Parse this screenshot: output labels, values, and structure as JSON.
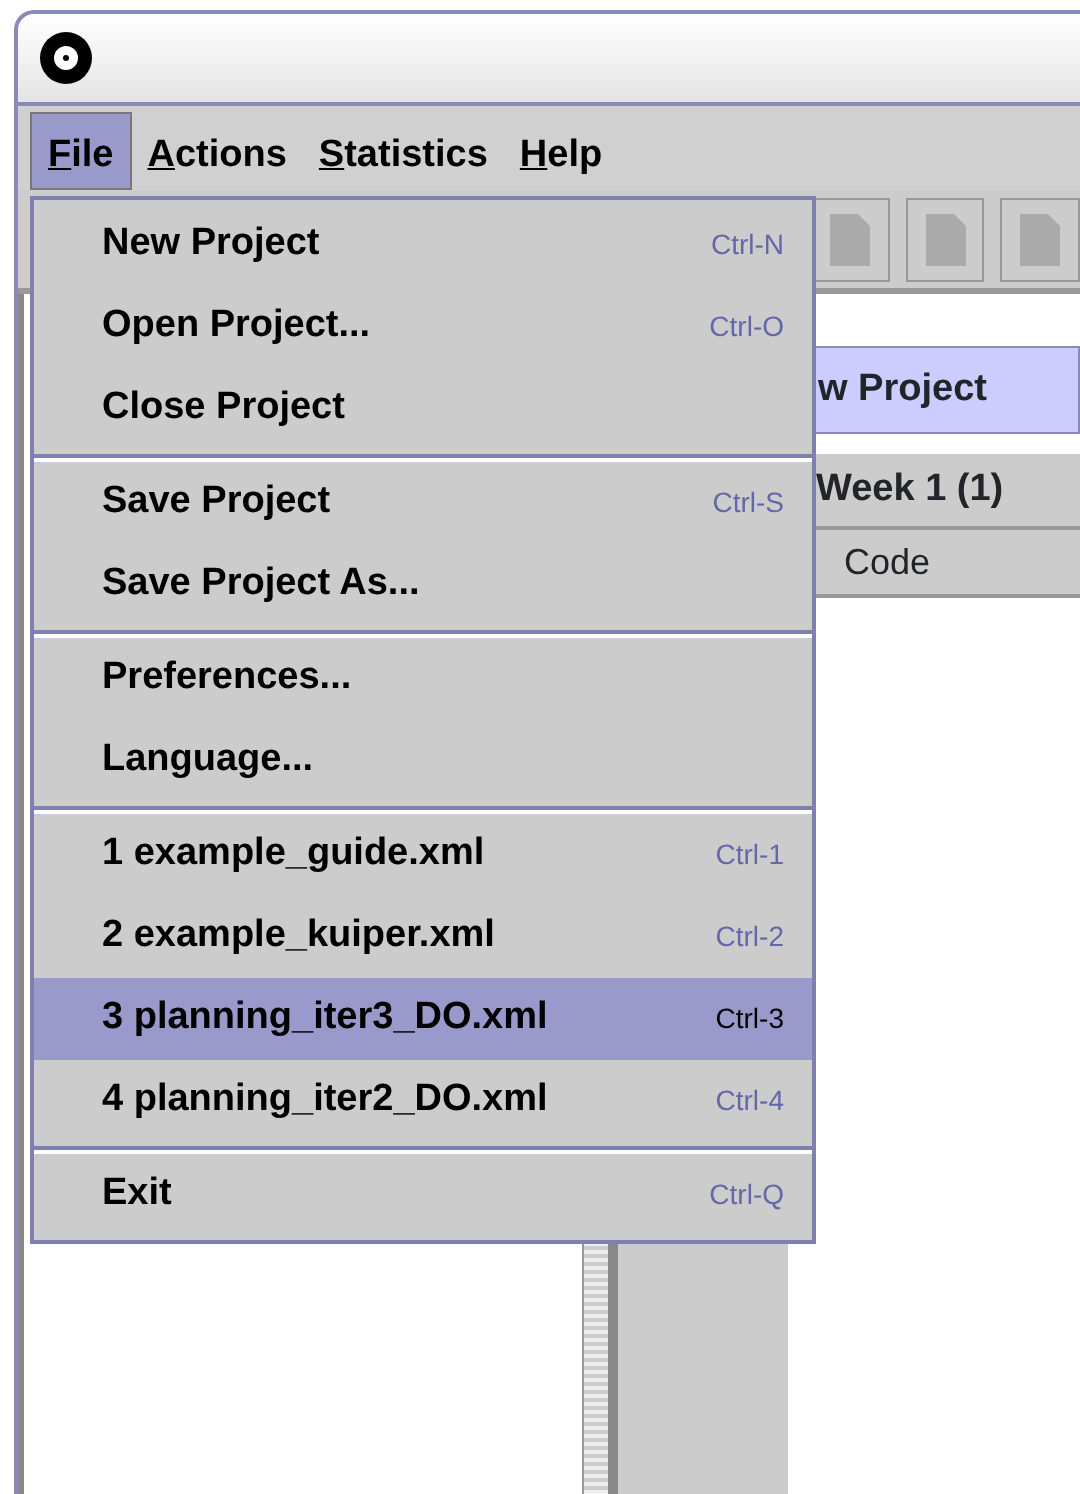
{
  "menubar": [
    {
      "label": "File",
      "selected": true
    },
    {
      "label": "Actions",
      "selected": false
    },
    {
      "label": "Statistics",
      "selected": false
    },
    {
      "label": "Help",
      "selected": false
    }
  ],
  "file_menu": {
    "sections": [
      [
        {
          "label": "New Project",
          "shortcut": "Ctrl-N",
          "selected": false
        },
        {
          "label": "Open Project...",
          "shortcut": "Ctrl-O",
          "selected": false
        },
        {
          "label": "Close Project",
          "selected": false
        }
      ],
      [
        {
          "label": "Save Project",
          "shortcut": "Ctrl-S",
          "selected": false
        },
        {
          "label": "Save Project As...",
          "selected": false
        }
      ],
      [
        {
          "label": "Preferences...",
          "selected": false
        },
        {
          "label": "Language...",
          "selected": false
        }
      ],
      [
        {
          "label": "1 example_guide.xml",
          "shortcut": "Ctrl-1",
          "selected": false
        },
        {
          "label": "2 example_kuiper.xml",
          "shortcut": "Ctrl-2",
          "selected": false
        },
        {
          "label": "3 planning_iter3_DO.xml",
          "shortcut": "Ctrl-3",
          "selected": true
        },
        {
          "label": "4 planning_iter2_DO.xml",
          "shortcut": "Ctrl-4",
          "selected": false
        }
      ],
      [
        {
          "label": "Exit",
          "shortcut": "Ctrl-Q",
          "selected": false
        }
      ]
    ]
  },
  "panel": {
    "title": "w Project",
    "week": "Week 1 (1)",
    "column": "Code"
  }
}
